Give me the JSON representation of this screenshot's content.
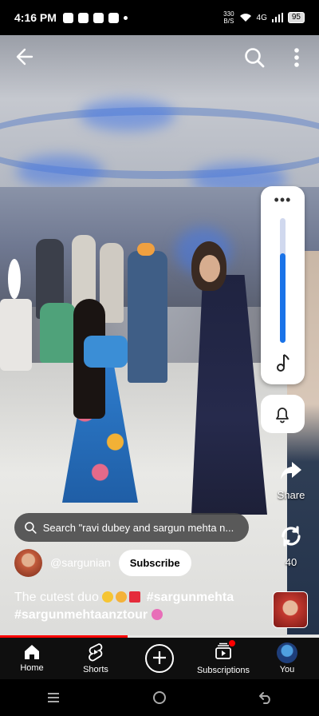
{
  "status_bar": {
    "time": "4:16 PM",
    "net_speed_value": "330",
    "net_speed_unit": "B/S",
    "network": "4G",
    "battery": "95"
  },
  "search_suggestion": "Search \"ravi dubey and sargun mehta n...",
  "channel": {
    "handle": "@sargunian",
    "subscribe_label": "Subscribe"
  },
  "caption": {
    "text": "The cutest duo",
    "tag1": "#sargunmehta",
    "tag2": "#sargunmehtaanztour"
  },
  "actions": {
    "share_label": "Share",
    "remix_count": "40"
  },
  "volume": {
    "level": 0.72
  },
  "progress": {
    "played_fraction": 0.4
  },
  "bottom_nav": {
    "home": "Home",
    "shorts": "Shorts",
    "subscriptions": "Subscriptions",
    "you": "You"
  },
  "icons": {
    "back": "arrow-left-icon",
    "search": "search-icon",
    "more": "more-vert-icon",
    "music": "music-note-icon",
    "bell": "bell-icon",
    "share": "share-icon",
    "remix": "remix-icon"
  },
  "colors": {
    "accent_red": "#ff0000",
    "volume_blue": "#1a73e8"
  }
}
